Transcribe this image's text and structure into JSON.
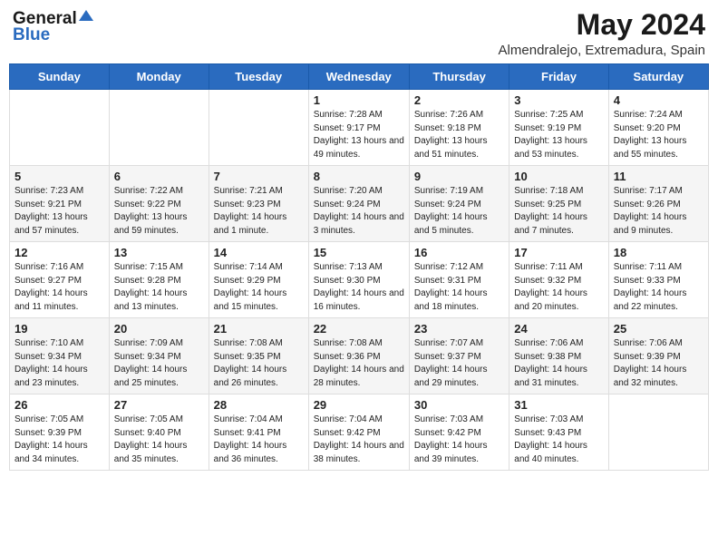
{
  "logo": {
    "general": "General",
    "blue": "Blue"
  },
  "title": "May 2024",
  "location": "Almendralejo, Extremadura, Spain",
  "weekdays": [
    "Sunday",
    "Monday",
    "Tuesday",
    "Wednesday",
    "Thursday",
    "Friday",
    "Saturday"
  ],
  "weeks": [
    [
      {
        "day": "",
        "info": ""
      },
      {
        "day": "",
        "info": ""
      },
      {
        "day": "",
        "info": ""
      },
      {
        "day": "1",
        "sunrise": "Sunrise: 7:28 AM",
        "sunset": "Sunset: 9:17 PM",
        "daylight": "Daylight: 13 hours and 49 minutes."
      },
      {
        "day": "2",
        "sunrise": "Sunrise: 7:26 AM",
        "sunset": "Sunset: 9:18 PM",
        "daylight": "Daylight: 13 hours and 51 minutes."
      },
      {
        "day": "3",
        "sunrise": "Sunrise: 7:25 AM",
        "sunset": "Sunset: 9:19 PM",
        "daylight": "Daylight: 13 hours and 53 minutes."
      },
      {
        "day": "4",
        "sunrise": "Sunrise: 7:24 AM",
        "sunset": "Sunset: 9:20 PM",
        "daylight": "Daylight: 13 hours and 55 minutes."
      }
    ],
    [
      {
        "day": "5",
        "sunrise": "Sunrise: 7:23 AM",
        "sunset": "Sunset: 9:21 PM",
        "daylight": "Daylight: 13 hours and 57 minutes."
      },
      {
        "day": "6",
        "sunrise": "Sunrise: 7:22 AM",
        "sunset": "Sunset: 9:22 PM",
        "daylight": "Daylight: 13 hours and 59 minutes."
      },
      {
        "day": "7",
        "sunrise": "Sunrise: 7:21 AM",
        "sunset": "Sunset: 9:23 PM",
        "daylight": "Daylight: 14 hours and 1 minute."
      },
      {
        "day": "8",
        "sunrise": "Sunrise: 7:20 AM",
        "sunset": "Sunset: 9:24 PM",
        "daylight": "Daylight: 14 hours and 3 minutes."
      },
      {
        "day": "9",
        "sunrise": "Sunrise: 7:19 AM",
        "sunset": "Sunset: 9:24 PM",
        "daylight": "Daylight: 14 hours and 5 minutes."
      },
      {
        "day": "10",
        "sunrise": "Sunrise: 7:18 AM",
        "sunset": "Sunset: 9:25 PM",
        "daylight": "Daylight: 14 hours and 7 minutes."
      },
      {
        "day": "11",
        "sunrise": "Sunrise: 7:17 AM",
        "sunset": "Sunset: 9:26 PM",
        "daylight": "Daylight: 14 hours and 9 minutes."
      }
    ],
    [
      {
        "day": "12",
        "sunrise": "Sunrise: 7:16 AM",
        "sunset": "Sunset: 9:27 PM",
        "daylight": "Daylight: 14 hours and 11 minutes."
      },
      {
        "day": "13",
        "sunrise": "Sunrise: 7:15 AM",
        "sunset": "Sunset: 9:28 PM",
        "daylight": "Daylight: 14 hours and 13 minutes."
      },
      {
        "day": "14",
        "sunrise": "Sunrise: 7:14 AM",
        "sunset": "Sunset: 9:29 PM",
        "daylight": "Daylight: 14 hours and 15 minutes."
      },
      {
        "day": "15",
        "sunrise": "Sunrise: 7:13 AM",
        "sunset": "Sunset: 9:30 PM",
        "daylight": "Daylight: 14 hours and 16 minutes."
      },
      {
        "day": "16",
        "sunrise": "Sunrise: 7:12 AM",
        "sunset": "Sunset: 9:31 PM",
        "daylight": "Daylight: 14 hours and 18 minutes."
      },
      {
        "day": "17",
        "sunrise": "Sunrise: 7:11 AM",
        "sunset": "Sunset: 9:32 PM",
        "daylight": "Daylight: 14 hours and 20 minutes."
      },
      {
        "day": "18",
        "sunrise": "Sunrise: 7:11 AM",
        "sunset": "Sunset: 9:33 PM",
        "daylight": "Daylight: 14 hours and 22 minutes."
      }
    ],
    [
      {
        "day": "19",
        "sunrise": "Sunrise: 7:10 AM",
        "sunset": "Sunset: 9:34 PM",
        "daylight": "Daylight: 14 hours and 23 minutes."
      },
      {
        "day": "20",
        "sunrise": "Sunrise: 7:09 AM",
        "sunset": "Sunset: 9:34 PM",
        "daylight": "Daylight: 14 hours and 25 minutes."
      },
      {
        "day": "21",
        "sunrise": "Sunrise: 7:08 AM",
        "sunset": "Sunset: 9:35 PM",
        "daylight": "Daylight: 14 hours and 26 minutes."
      },
      {
        "day": "22",
        "sunrise": "Sunrise: 7:08 AM",
        "sunset": "Sunset: 9:36 PM",
        "daylight": "Daylight: 14 hours and 28 minutes."
      },
      {
        "day": "23",
        "sunrise": "Sunrise: 7:07 AM",
        "sunset": "Sunset: 9:37 PM",
        "daylight": "Daylight: 14 hours and 29 minutes."
      },
      {
        "day": "24",
        "sunrise": "Sunrise: 7:06 AM",
        "sunset": "Sunset: 9:38 PM",
        "daylight": "Daylight: 14 hours and 31 minutes."
      },
      {
        "day": "25",
        "sunrise": "Sunrise: 7:06 AM",
        "sunset": "Sunset: 9:39 PM",
        "daylight": "Daylight: 14 hours and 32 minutes."
      }
    ],
    [
      {
        "day": "26",
        "sunrise": "Sunrise: 7:05 AM",
        "sunset": "Sunset: 9:39 PM",
        "daylight": "Daylight: 14 hours and 34 minutes."
      },
      {
        "day": "27",
        "sunrise": "Sunrise: 7:05 AM",
        "sunset": "Sunset: 9:40 PM",
        "daylight": "Daylight: 14 hours and 35 minutes."
      },
      {
        "day": "28",
        "sunrise": "Sunrise: 7:04 AM",
        "sunset": "Sunset: 9:41 PM",
        "daylight": "Daylight: 14 hours and 36 minutes."
      },
      {
        "day": "29",
        "sunrise": "Sunrise: 7:04 AM",
        "sunset": "Sunset: 9:42 PM",
        "daylight": "Daylight: 14 hours and 38 minutes."
      },
      {
        "day": "30",
        "sunrise": "Sunrise: 7:03 AM",
        "sunset": "Sunset: 9:42 PM",
        "daylight": "Daylight: 14 hours and 39 minutes."
      },
      {
        "day": "31",
        "sunrise": "Sunrise: 7:03 AM",
        "sunset": "Sunset: 9:43 PM",
        "daylight": "Daylight: 14 hours and 40 minutes."
      },
      {
        "day": "",
        "info": ""
      }
    ]
  ]
}
